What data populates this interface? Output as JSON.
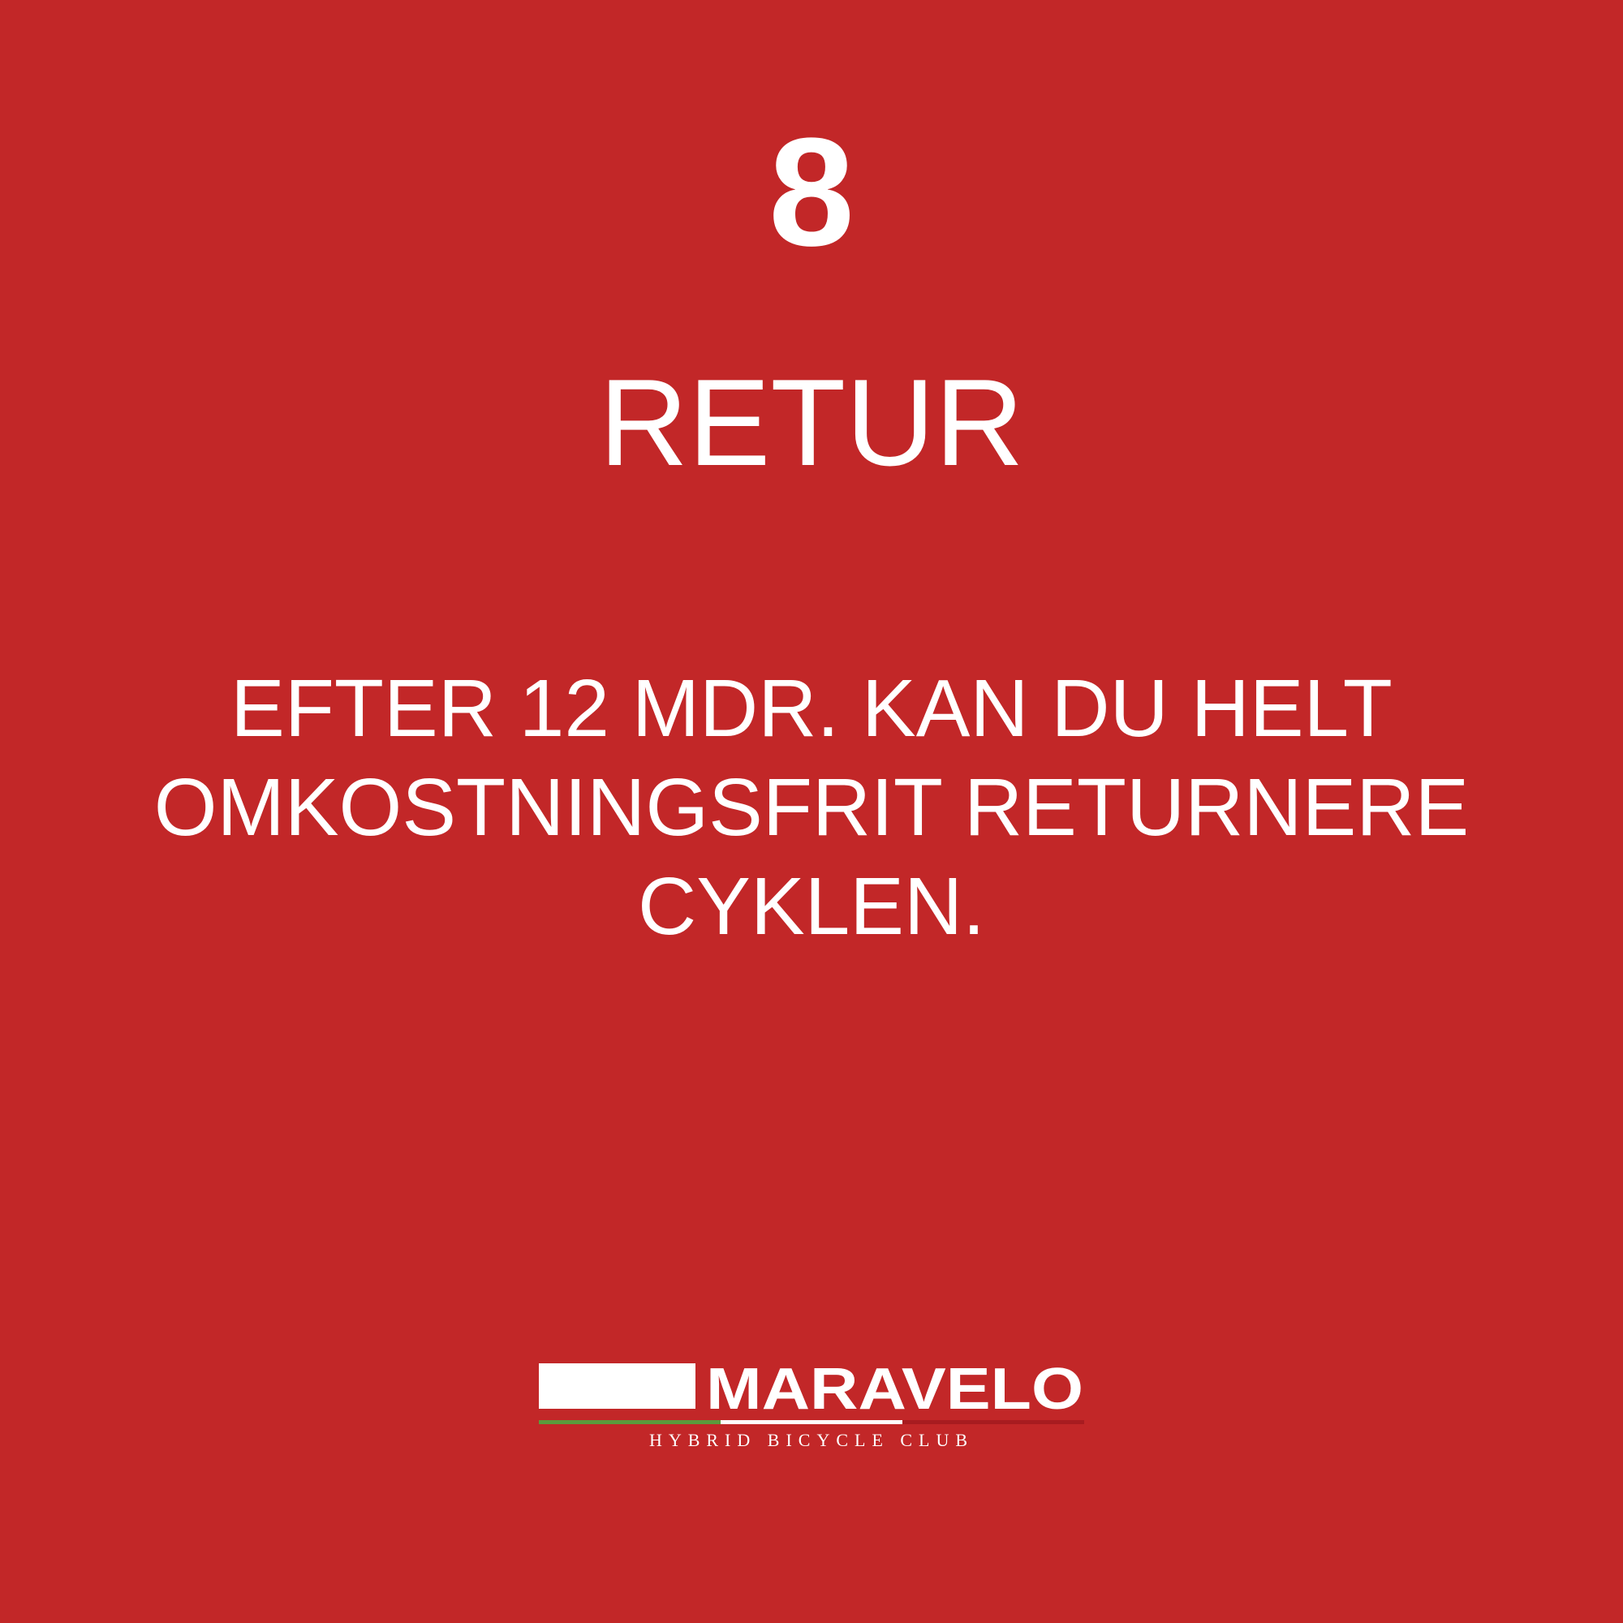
{
  "slide": {
    "step_number": "8",
    "title": "RETUR",
    "body_lines": [
      "EFTER 12 MDR. KAN DU HELT",
      "OMKOSTNINGSFRIT RETURNERE",
      "CYKLEN."
    ]
  },
  "logo": {
    "wordmark": "MARAVELO",
    "tagline": "HYBRID BICYCLE CLUB"
  },
  "colors": {
    "background": "#c22728",
    "text": "#ffffff",
    "stripe_green": "#5b9a3c",
    "stripe_white": "#ffffff",
    "stripe_red": "#a81c20"
  }
}
